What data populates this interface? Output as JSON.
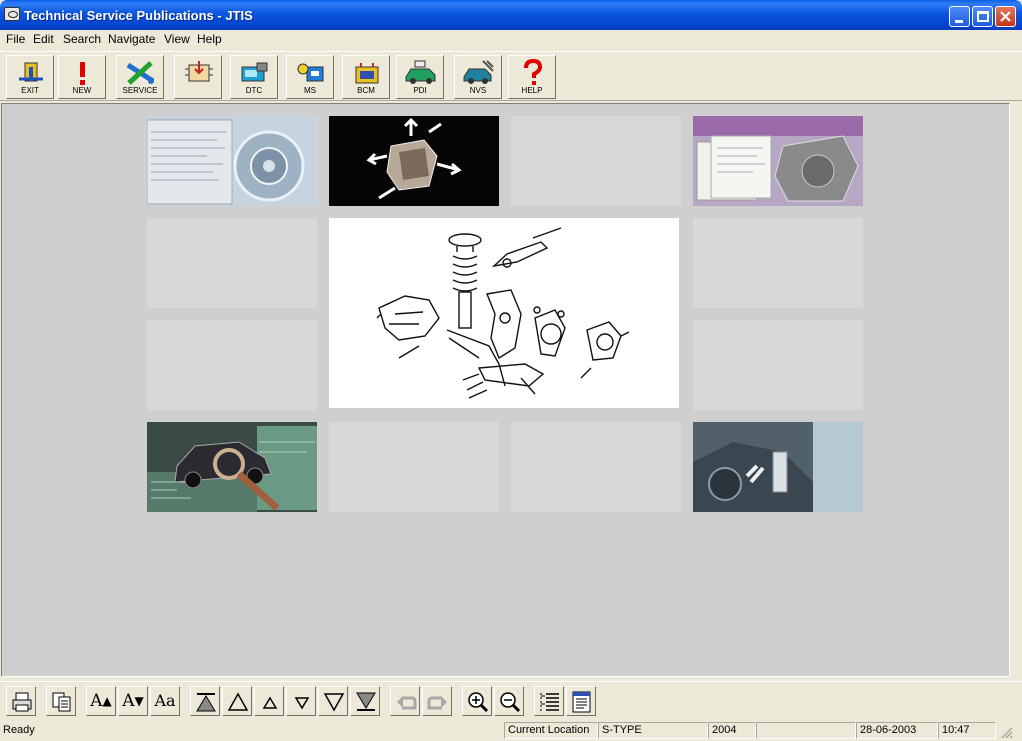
{
  "window": {
    "title": "Technical Service Publications - JTIS"
  },
  "menu": [
    "File",
    "Edit",
    "Search",
    "Navigate",
    "View",
    "Help"
  ],
  "toolbar": [
    {
      "label": "EXIT",
      "icon": "exit-icon"
    },
    {
      "label": "NEW",
      "icon": "exclamation-icon"
    },
    {
      "label": "SERVICE",
      "icon": "wrench-icon"
    },
    {
      "label": "",
      "icon": "module-icon"
    },
    {
      "label": "DTC",
      "icon": "dtc-icon"
    },
    {
      "label": "MS",
      "icon": "ms-icon"
    },
    {
      "label": "BCM",
      "icon": "bcm-icon"
    },
    {
      "label": "PDI",
      "icon": "pdi-icon"
    },
    {
      "label": "NVS",
      "icon": "nvs-icon"
    },
    {
      "label": "HELP",
      "icon": "question-icon"
    }
  ],
  "bottom_toolbar": {
    "font_larger": "A",
    "font_smaller": "A",
    "font_reset": "Aa"
  },
  "status": {
    "ready": "Ready",
    "location_label": "Current Location",
    "model": "S-TYPE",
    "year": "2004",
    "blank": "",
    "date": "28-06-2003",
    "time": "10:47"
  }
}
